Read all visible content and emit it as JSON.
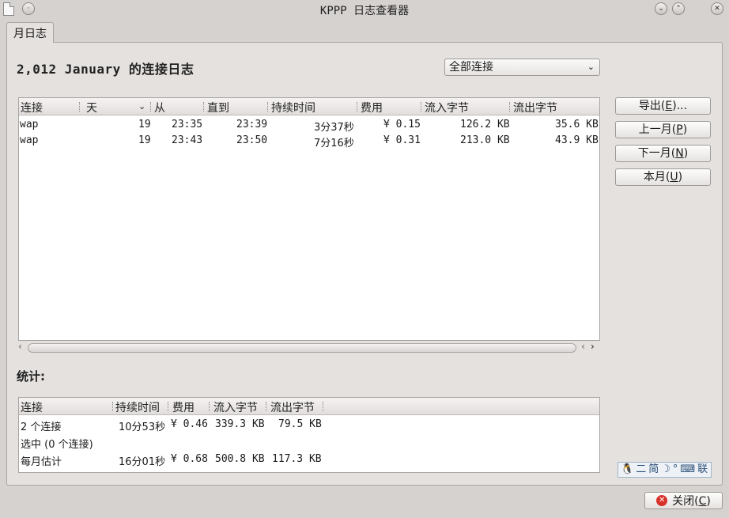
{
  "window": {
    "title": "KPPP 日志查看器",
    "controls": [
      "minimize",
      "maximize",
      "close"
    ]
  },
  "tab": {
    "label": "月日志"
  },
  "heading": "2,012 January 的连接日志",
  "filter": {
    "selected": "全部连接"
  },
  "log_table": {
    "columns": [
      "连接",
      "天",
      "从",
      "直到",
      "持续时间",
      "费用",
      "流入字节",
      "流出字节"
    ],
    "rows": [
      {
        "connection": "wap",
        "day": "19",
        "from": "23:35",
        "to": "23:39",
        "duration": "3分37秒",
        "cost": "¥ 0.15",
        "bytes_in": "126.2 KB",
        "bytes_out": "35.6 KB"
      },
      {
        "connection": "wap",
        "day": "19",
        "from": "23:43",
        "to": "23:50",
        "duration": "7分16秒",
        "cost": "¥ 0.31",
        "bytes_in": "213.0 KB",
        "bytes_out": "43.9 KB"
      }
    ]
  },
  "side_buttons": {
    "export": {
      "label": "导出(",
      "key": "E",
      "suffix": ")..."
    },
    "prev_month": {
      "label": "上一月(",
      "key": "P",
      "suffix": ")"
    },
    "next_month": {
      "label": "下一月(",
      "key": "N",
      "suffix": ")"
    },
    "this_month": {
      "label": "本月(",
      "key": "U",
      "suffix": ")"
    }
  },
  "stats": {
    "label": "统计:",
    "columns": [
      "连接",
      "持续时间",
      "费用",
      "流入字节",
      "流出字节"
    ],
    "rows": [
      {
        "connection": "2 个连接",
        "duration": "10分53秒",
        "cost": "¥ 0.46",
        "bytes_in": "339.3 KB",
        "bytes_out": "79.5 KB"
      },
      {
        "connection": "选中 (0 个连接)",
        "duration": "",
        "cost": "",
        "bytes_in": "",
        "bytes_out": ""
      },
      {
        "connection": "每月估计",
        "duration": "16分01秒",
        "cost": "¥ 0.68",
        "bytes_in": "500.8 KB",
        "bytes_out": "117.3 KB"
      }
    ]
  },
  "ime_tray": {
    "items": [
      "二",
      "简",
      "联"
    ]
  },
  "close_button": {
    "label": "关闭(",
    "key": "C",
    "suffix": ")"
  }
}
